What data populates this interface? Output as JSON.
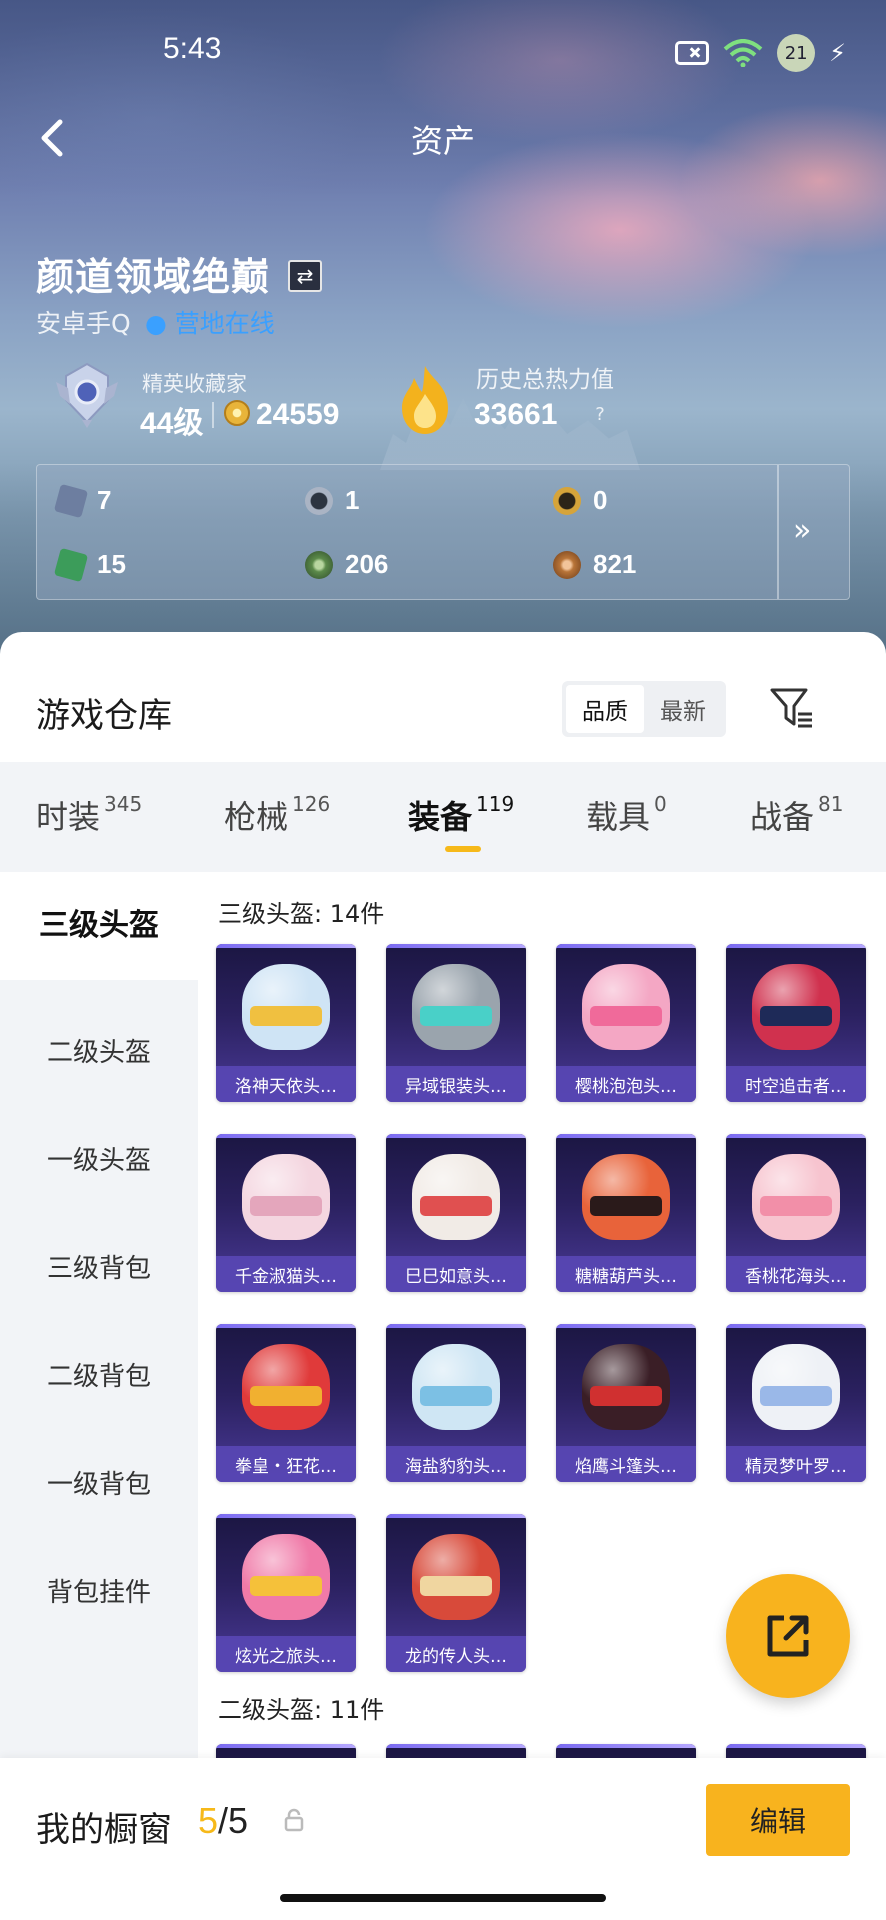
{
  "status_bar": {
    "time": "5:43",
    "battery_level": "21"
  },
  "header": {
    "title": "资产"
  },
  "profile": {
    "name": "颜道领域绝巅",
    "platform": "安卓手Q",
    "online_status": "营地在线",
    "rank_title": "精英收藏家",
    "rank_level": "44级",
    "rank_points": "24559",
    "heat_title": "历史总热力值",
    "heat_value": "33661",
    "help_symbol": "?"
  },
  "currencies": [
    {
      "icon": "card-icon",
      "value": "7",
      "color": "#6d7ea0"
    },
    {
      "icon": "silver-coin-icon",
      "value": "1",
      "color": "#aab4c4"
    },
    {
      "icon": "gold-token-icon",
      "value": "0",
      "color": "#d6a43a"
    },
    {
      "icon": "ticket-icon",
      "value": "15",
      "color": "#3c9c5a"
    },
    {
      "icon": "green-orb-icon",
      "value": "206",
      "color": "#5b8a4a"
    },
    {
      "icon": "bronze-coin-icon",
      "value": "821",
      "color": "#b87438"
    }
  ],
  "panel_more_symbol": "»",
  "warehouse": {
    "title": "游戏仓库",
    "sort_options": [
      "品质",
      "最新"
    ],
    "selected_sort": "品质"
  },
  "tabs": [
    {
      "label": "时装",
      "count": "345"
    },
    {
      "label": "枪械",
      "count": "126"
    },
    {
      "label": "装备",
      "count": "119"
    },
    {
      "label": "载具",
      "count": "0"
    },
    {
      "label": "战备",
      "count": "81"
    }
  ],
  "active_tab": "装备",
  "subnav": [
    "三级头盔",
    "二级头盔",
    "一级头盔",
    "三级背包",
    "二级背包",
    "一级背包",
    "背包挂件"
  ],
  "active_subnav": "三级头盔",
  "sections": [
    {
      "label": "三级头盔: 14件",
      "items": [
        {
          "name": "洛神天依头…",
          "helmet_color": "#cfe4f5",
          "visor_color": "#f0c040"
        },
        {
          "name": "异域银装头…",
          "helmet_color": "#9aa4ad",
          "visor_color": "#49d0c8"
        },
        {
          "name": "樱桃泡泡头…",
          "helmet_color": "#f4a7c4",
          "visor_color": "#f06a9a"
        },
        {
          "name": "时空追击者…",
          "helmet_color": "#d0314e",
          "visor_color": "#1e2a58"
        },
        {
          "name": "千金淑猫头…",
          "helmet_color": "#f4d6e0",
          "visor_color": "#e4a6bc"
        },
        {
          "name": "巳巳如意头…",
          "helmet_color": "#f1ebe6",
          "visor_color": "#e05050"
        },
        {
          "name": "糖糖葫芦头…",
          "helmet_color": "#e8633a",
          "visor_color": "#2a1a1a"
        },
        {
          "name": "香桃花海头…",
          "helmet_color": "#f7c4cf",
          "visor_color": "#f28fa8"
        },
        {
          "name": "拳皇・狂花…",
          "helmet_color": "#e03a3a",
          "visor_color": "#f1b030"
        },
        {
          "name": "海盐豹豹头…",
          "helmet_color": "#cfe6f4",
          "visor_color": "#7cc0e4"
        },
        {
          "name": "焰鹰斗篷头…",
          "helmet_color": "#3a1e26",
          "visor_color": "#d03030"
        },
        {
          "name": "精灵梦叶罗…",
          "helmet_color": "#eef1f6",
          "visor_color": "#9ab8e8"
        },
        {
          "name": "炫光之旅头…",
          "helmet_color": "#f07aa8",
          "visor_color": "#f5c13a"
        },
        {
          "name": "龙的传人头…",
          "helmet_color": "#d84a3a",
          "visor_color": "#f0d6a0"
        }
      ]
    },
    {
      "label": "二级头盔: 11件",
      "items": []
    }
  ],
  "showcase": {
    "label": "我的橱窗",
    "current": "5",
    "total": "/5",
    "edit_label": "编辑"
  },
  "colors": {
    "accent": "#f6b91a",
    "online": "#3aa0ff",
    "card_name_bar": "#5846b4"
  }
}
